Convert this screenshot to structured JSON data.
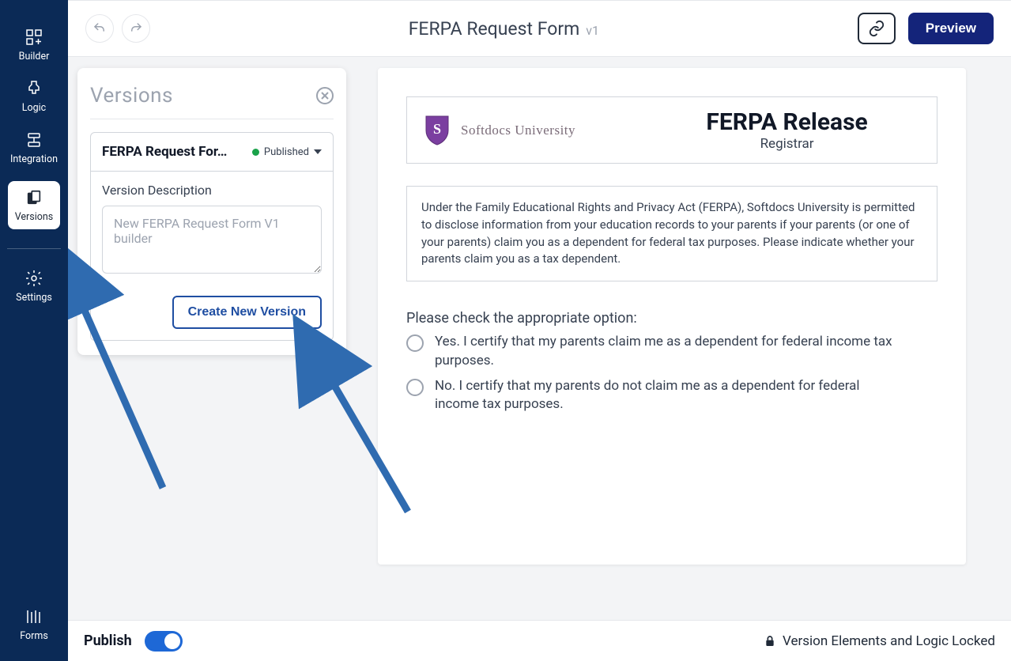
{
  "sidebar": {
    "items": [
      {
        "key": "builder",
        "label": "Builder"
      },
      {
        "key": "logic",
        "label": "Logic"
      },
      {
        "key": "integration",
        "label": "Integration"
      },
      {
        "key": "versions",
        "label": "Versions",
        "active": true
      },
      {
        "key": "settings",
        "label": "Settings"
      }
    ],
    "footer_item": {
      "key": "forms",
      "label": "Forms"
    }
  },
  "topbar": {
    "title": "FERPA Request Form",
    "version": "v1",
    "preview_label": "Preview"
  },
  "versions_panel": {
    "heading": "Versions",
    "current_name": "FERPA Request For…",
    "status_label": "Published",
    "description_label": "Version Description",
    "description_placeholder": "New FERPA Request Form V1 builder",
    "create_button": "Create New Version"
  },
  "form_preview": {
    "brand_name": "Softdocs University",
    "title": "FERPA Release",
    "subtitle": "Registrar",
    "info_text": "Under the Family Educational Rights and Privacy Act (FERPA), Softdocs University is permitted to disclose information from your education records to your parents if your parents (or one of your parents) claim you as a dependent for federal tax purposes. Please indicate whether your parents claim you as a tax dependent.",
    "question_label": "Please check the appropriate option:",
    "options": [
      "Yes. I certify that my parents claim me as a dependent for federal income tax purposes.",
      "No. I certify that my parents do not claim me as a dependent for federal income tax purposes."
    ]
  },
  "footer": {
    "publish_label": "Publish",
    "lock_status": "Version Elements and Logic Locked"
  },
  "colors": {
    "navy": "#0b2a56",
    "accent_blue": "#1f4ea2",
    "green": "#1aa24a"
  }
}
